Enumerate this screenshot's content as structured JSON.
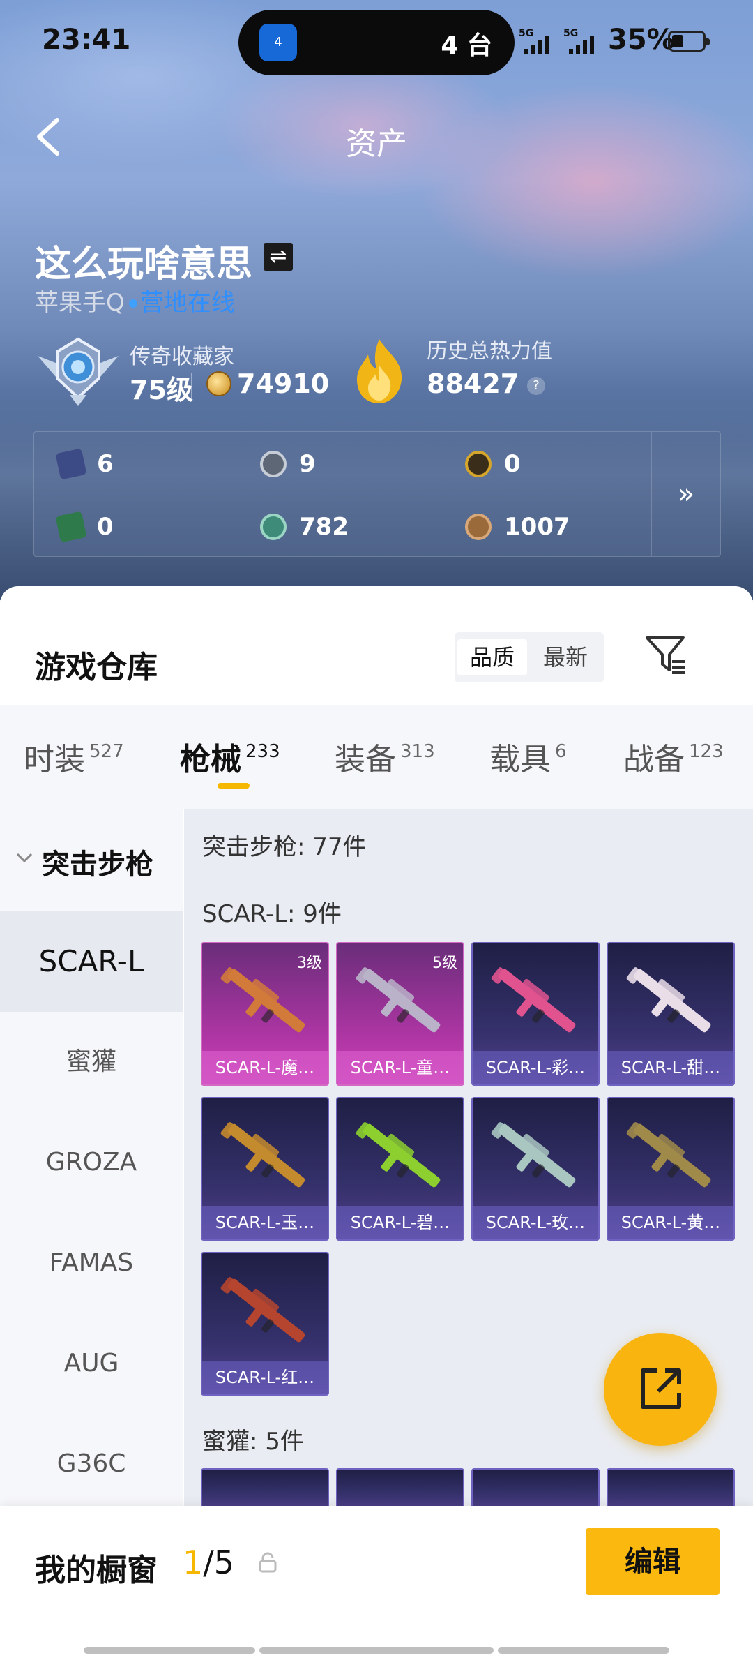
{
  "status_bar": {
    "time": "23:41",
    "island_app": "4",
    "island_text": "4 台",
    "signal1": "5G",
    "signal2": "5G",
    "battery": "35%"
  },
  "header": {
    "title": "资产"
  },
  "profile": {
    "name": "这么玩啥意思",
    "platform": "苹果手Q",
    "online": "营地在线",
    "rank_label": "传奇收藏家",
    "level": "75级",
    "coins": "74910",
    "heat_label": "历史总热力值",
    "heat_value": "88427",
    "help": "?"
  },
  "stats": [
    {
      "value": "6",
      "color": "#3c4a86"
    },
    {
      "value": "9",
      "color": "#5d6775"
    },
    {
      "value": "0",
      "color": "#b8892a"
    },
    {
      "value": "0",
      "color": "#2f7a4a"
    },
    {
      "value": "782",
      "color": "#3f8b7a"
    },
    {
      "value": "1007",
      "color": "#9a6a3a"
    }
  ],
  "stats_more": "»",
  "warehouse": {
    "title": "游戏仓库",
    "sort": [
      "品质",
      "最新"
    ],
    "filter_icon": "filter-icon"
  },
  "tabs": [
    {
      "label": "时装",
      "count": "527"
    },
    {
      "label": "枪械",
      "count": "233"
    },
    {
      "label": "装备",
      "count": "313"
    },
    {
      "label": "载具",
      "count": "6"
    },
    {
      "label": "战备",
      "count": "123"
    }
  ],
  "sidebar": {
    "category": "突击步枪",
    "items": [
      "SCAR-L",
      "蜜獾",
      "GROZA",
      "FAMAS",
      "AUG",
      "G36C"
    ]
  },
  "content": {
    "category_count": "突击步枪: 77件",
    "group1_title": "SCAR-L: 9件",
    "group2_title": "蜜獾: 5件",
    "tiles": [
      {
        "name": "SCAR-L-魔…",
        "level": "3级",
        "style": "pink",
        "color": "#d27a3a"
      },
      {
        "name": "SCAR-L-童…",
        "level": "5级",
        "style": "pink",
        "color": "#b9b2c8"
      },
      {
        "name": "SCAR-L-彩…",
        "level": "",
        "style": "blue",
        "color": "#e0538f"
      },
      {
        "name": "SCAR-L-甜…",
        "level": "",
        "style": "blue",
        "color": "#e9dde8"
      },
      {
        "name": "SCAR-L-玉…",
        "level": "",
        "style": "blue",
        "color": "#c48a2e"
      },
      {
        "name": "SCAR-L-碧…",
        "level": "",
        "style": "blue",
        "color": "#8ccf2e"
      },
      {
        "name": "SCAR-L-玫…",
        "level": "",
        "style": "blue",
        "color": "#a9c6c1"
      },
      {
        "name": "SCAR-L-黄…",
        "level": "",
        "style": "blue",
        "color": "#a08a4a"
      },
      {
        "name": "SCAR-L-红…",
        "level": "",
        "style": "blue",
        "color": "#b5452f"
      }
    ]
  },
  "bottom": {
    "window_label": "我的橱窗",
    "window_current": "1",
    "window_total": "/5",
    "edit": "编辑"
  }
}
